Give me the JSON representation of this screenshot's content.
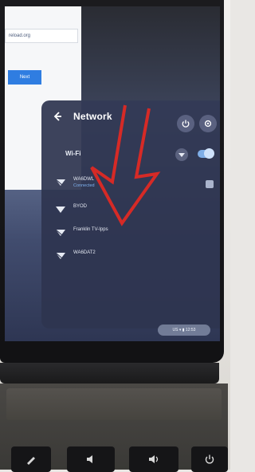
{
  "browser": {
    "url_fragment": "reload.org",
    "next_label": "Next"
  },
  "panel": {
    "title": "Network",
    "wifi_label": "Wi-Fi",
    "networks": [
      {
        "name": "WA6DWL",
        "status": "Connected",
        "signal": "strong"
      },
      {
        "name": "BYOD",
        "status": "",
        "signal": "strong"
      },
      {
        "name": "Franklin TV-Ipps",
        "status": "",
        "signal": "medium"
      },
      {
        "name": "WA6DAT2",
        "status": "",
        "signal": "medium"
      }
    ],
    "status_tray": "US ▾ ▮ 12:53"
  },
  "icons": {
    "back": "arrow-left-icon",
    "power": "power-icon",
    "settings": "gear-icon",
    "wifi_action": "wifi-lock-icon",
    "toggle": "wifi-toggle",
    "keys": [
      "pen-key-icon",
      "volume-down-icon",
      "volume-up-icon",
      "power-key-icon"
    ]
  },
  "colors": {
    "panel": "#2e3550",
    "connected": "#7fb2f0",
    "toggle_on": "#7faee7",
    "annotation_arrow": "#d62a26"
  }
}
